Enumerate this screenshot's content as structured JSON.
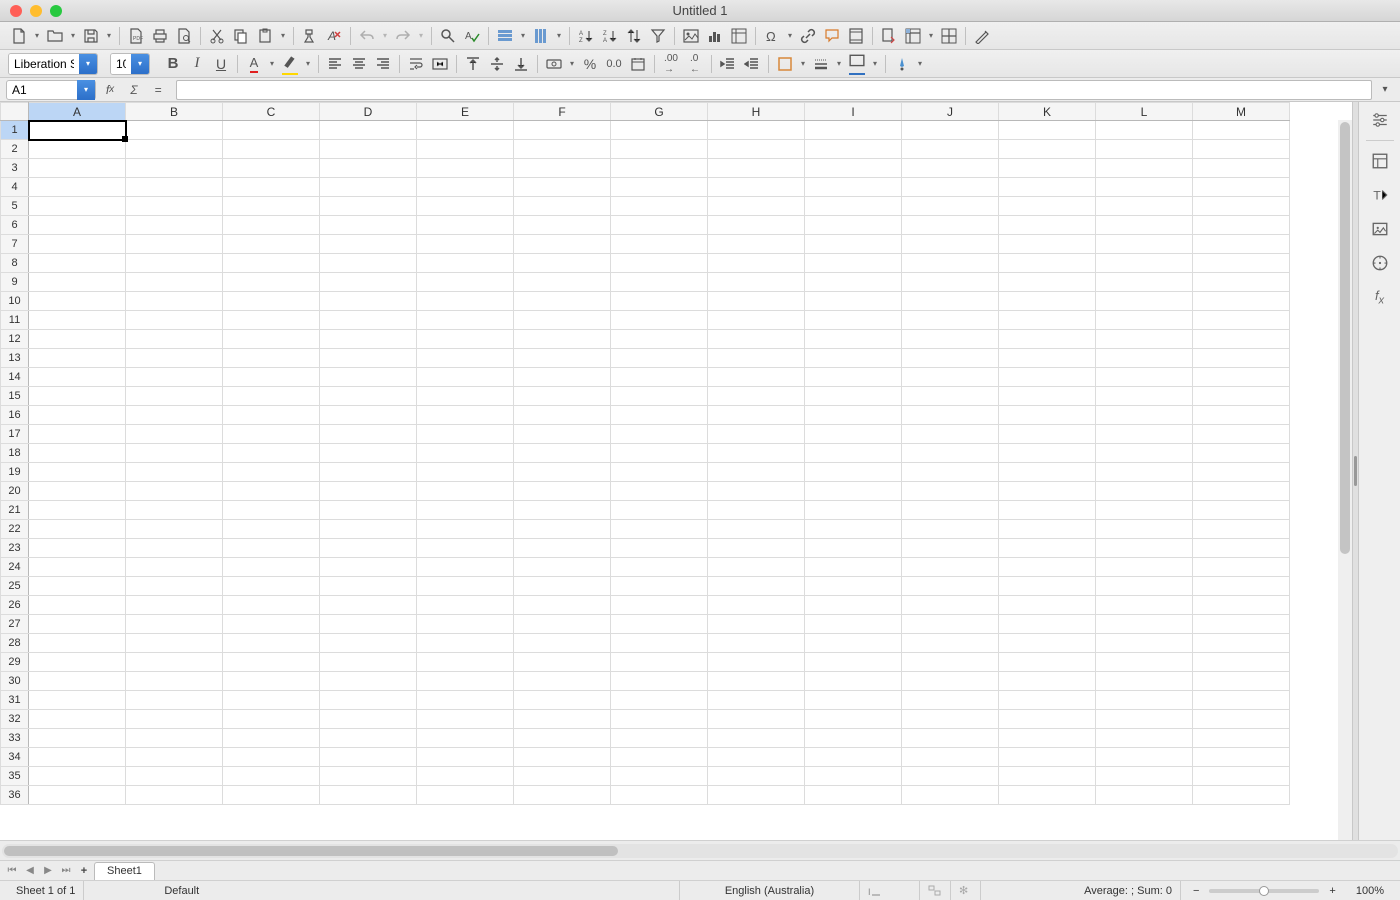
{
  "window": {
    "title": "Untitled 1"
  },
  "toolbar": {
    "font_name": "Liberation Sans",
    "font_size": "10"
  },
  "formula_bar": {
    "cell_ref": "A1",
    "formula": ""
  },
  "columns": [
    "A",
    "B",
    "C",
    "D",
    "E",
    "F",
    "G",
    "H",
    "I",
    "J",
    "K",
    "L",
    "M"
  ],
  "rows": [
    "1",
    "2",
    "3",
    "4",
    "5",
    "6",
    "7",
    "8",
    "9",
    "10",
    "11",
    "12",
    "13",
    "14",
    "15",
    "16",
    "17",
    "18",
    "19",
    "20",
    "21",
    "22",
    "23",
    "24",
    "25",
    "26",
    "27",
    "28",
    "29",
    "30",
    "31",
    "32",
    "33",
    "34",
    "35",
    "36"
  ],
  "active_cell": {
    "col": "A",
    "row": "1"
  },
  "sheet_tab": "Sheet1",
  "statusbar": {
    "sheet_info": "Sheet 1 of 1",
    "style": "Default",
    "language": "English (Australia)",
    "stats": "Average: ; Sum: 0",
    "zoom": "100%",
    "zoom_minus": "−",
    "zoom_plus": "+"
  }
}
